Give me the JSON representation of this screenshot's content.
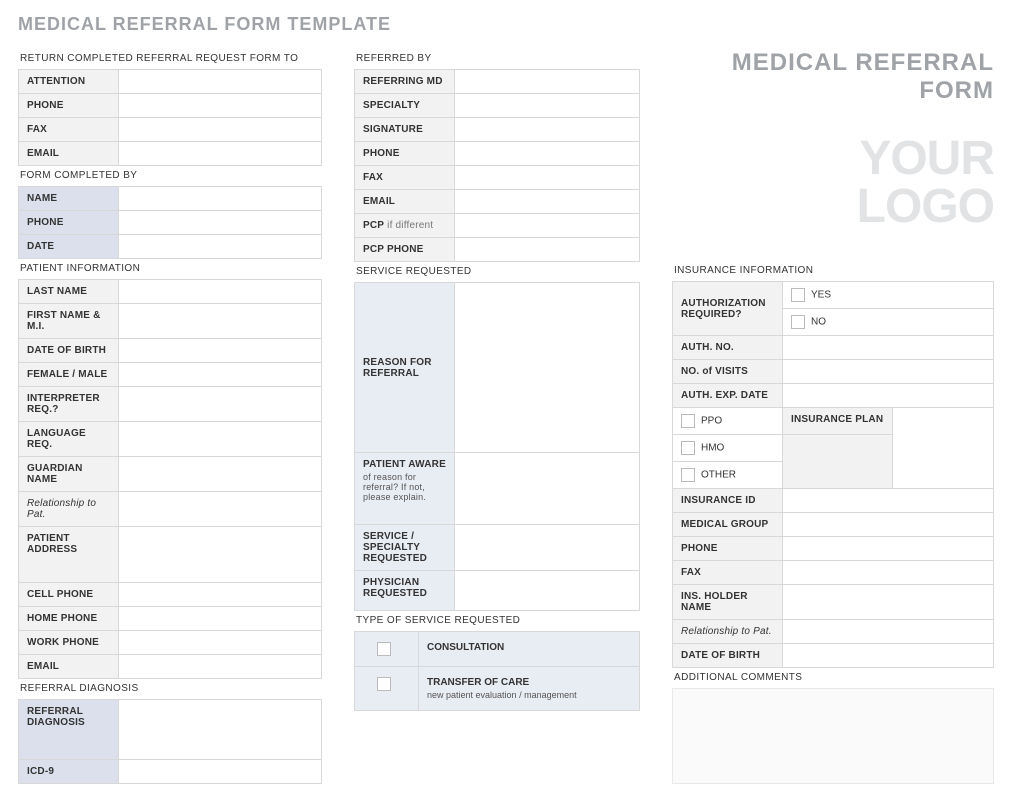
{
  "page_title": "MEDICAL REFERRAL FORM TEMPLATE",
  "header": {
    "form_title": "MEDICAL REFERRAL FORM",
    "logo_line1": "YOUR",
    "logo_line2": "LOGO"
  },
  "return_to": {
    "section": "RETURN COMPLETED REFERRAL REQUEST FORM TO",
    "attention": "ATTENTION",
    "phone": "PHONE",
    "fax": "FAX",
    "email": "EMAIL"
  },
  "completed_by": {
    "section": "FORM COMPLETED BY",
    "name": "NAME",
    "phone": "PHONE",
    "date": "DATE"
  },
  "patient": {
    "section": "PATIENT INFORMATION",
    "last_name": "LAST NAME",
    "first_mi": "FIRST NAME & M.I.",
    "dob": "DATE OF BIRTH",
    "sex": "FEMALE / MALE",
    "interp": "INTERPRETER REQ.?",
    "lang": "LANGUAGE REQ.",
    "guardian": "GUARDIAN NAME",
    "rel": "Relationship to Pat.",
    "addr": "PATIENT ADDRESS",
    "cell": "CELL PHONE",
    "home": "HOME PHONE",
    "work": "WORK PHONE",
    "email": "EMAIL"
  },
  "diagnosis": {
    "section": "REFERRAL DIAGNOSIS",
    "label": "REFERRAL DIAGNOSIS",
    "icd9": "ICD-9"
  },
  "referred_by": {
    "section": "REFERRED BY",
    "md": "REFERRING MD",
    "specialty": "SPECIALTY",
    "signature": "SIGNATURE",
    "phone": "PHONE",
    "fax": "FAX",
    "email": "EMAIL",
    "pcp": "PCP",
    "pcp_sub": " if different",
    "pcp_phone": "PCP PHONE"
  },
  "service": {
    "section": "SERVICE REQUESTED",
    "reason": "REASON FOR REFERRAL",
    "aware": "PATIENT AWARE",
    "aware_sub": "of reason for referral?  If not, please explain.",
    "spec_req": "SERVICE / SPECIALTY REQUESTED",
    "phys_req": "PHYSICIAN REQUESTED"
  },
  "type": {
    "section": "TYPE OF SERVICE REQUESTED",
    "consult": "CONSULTATION",
    "transfer": "TRANSFER OF CARE",
    "transfer_sub": "new patient evaluation / management"
  },
  "insurance": {
    "section": "INSURANCE INFORMATION",
    "auth_req": "AUTHORIZATION REQUIRED?",
    "yes": "YES",
    "no": "NO",
    "auth_no": "AUTH. NO.",
    "visits": "NO. of VISITS",
    "exp": "AUTH. EXP. DATE",
    "ppo": "PPO",
    "hmo": "HMO",
    "other": "OTHER",
    "plan": "INSURANCE PLAN",
    "id": "INSURANCE ID",
    "group": "MEDICAL GROUP",
    "phone": "PHONE",
    "fax": "FAX",
    "holder": "INS. HOLDER NAME",
    "rel": "Relationship to Pat.",
    "dob": "DATE OF BIRTH"
  },
  "comments": {
    "section": "ADDITIONAL COMMENTS"
  }
}
